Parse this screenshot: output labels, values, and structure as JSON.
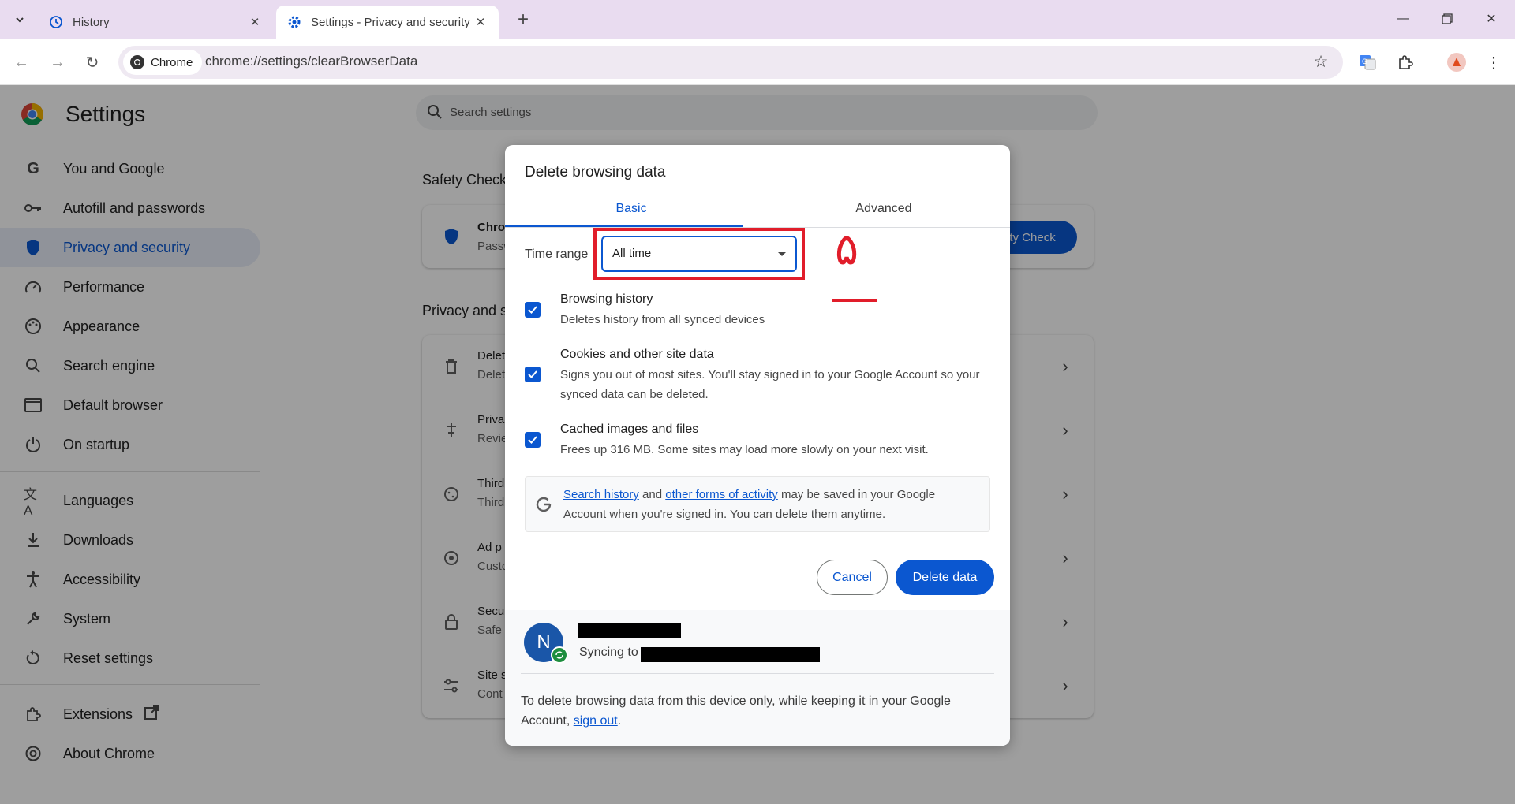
{
  "browser": {
    "tabs": [
      {
        "title": "History",
        "icon": "history-icon"
      },
      {
        "title": "Settings - Privacy and security",
        "icon": "gear-icon"
      }
    ],
    "chip_label": "Chrome",
    "url": "chrome://settings/clearBrowserData"
  },
  "settings": {
    "title": "Settings",
    "search_placeholder": "Search settings",
    "nav": [
      {
        "label": "You and Google",
        "icon": "google-g-icon"
      },
      {
        "label": "Autofill and passwords",
        "icon": "key-icon"
      },
      {
        "label": "Privacy and security",
        "icon": "shield-icon",
        "active": true
      },
      {
        "label": "Performance",
        "icon": "speedometer-icon"
      },
      {
        "label": "Appearance",
        "icon": "palette-icon"
      },
      {
        "label": "Search engine",
        "icon": "search-icon"
      },
      {
        "label": "Default browser",
        "icon": "browser-window-icon"
      },
      {
        "label": "On startup",
        "icon": "power-icon"
      },
      {
        "label": "Languages",
        "icon": "translate-icon"
      },
      {
        "label": "Downloads",
        "icon": "download-icon"
      },
      {
        "label": "Accessibility",
        "icon": "accessibility-icon"
      },
      {
        "label": "System",
        "icon": "wrench-icon"
      },
      {
        "label": "Reset settings",
        "icon": "reset-icon"
      },
      {
        "label": "Extensions",
        "icon": "puzzle-icon"
      },
      {
        "label": "About Chrome",
        "icon": "chrome-icon"
      }
    ],
    "safety_check_title": "Safety Check",
    "safety_row_title": "Chron",
    "safety_row_sub": "Passw",
    "safety_button": "ety Check",
    "privacy_title": "Privacy and s",
    "privacy_rows": [
      {
        "title": "Delet",
        "sub": "Delet",
        "icon": "trash-icon"
      },
      {
        "title": "Priva",
        "sub": "Revie",
        "icon": "tune-icon"
      },
      {
        "title": "Third",
        "sub": "Third",
        "icon": "cookie-icon"
      },
      {
        "title": "Ad p",
        "sub": "Custo",
        "icon": "ad-privacy-icon"
      },
      {
        "title": "Secu",
        "sub": "Safe",
        "icon": "lock-icon"
      },
      {
        "title": "Site s",
        "sub": "Cont",
        "icon": "sliders-icon"
      }
    ]
  },
  "dialog": {
    "title": "Delete browsing data",
    "tabs": [
      "Basic",
      "Advanced"
    ],
    "time_range_label": "Time range",
    "time_range_value": "All time",
    "annotation_glyph": "۵",
    "options": [
      {
        "title": "Browsing history",
        "desc": "Deletes history from all synced devices",
        "checked": true
      },
      {
        "title": "Cookies and other site data",
        "desc": "Signs you out of most sites. You'll stay signed in to your Google Account so your synced data can be deleted.",
        "checked": true
      },
      {
        "title": "Cached images and files",
        "desc": "Frees up 316 MB. Some sites may load more slowly on your next visit.",
        "checked": true
      }
    ],
    "google_notice": {
      "link1": "Search history",
      "mid1": " and ",
      "link2": "other forms of activity",
      "rest": " may be saved in your Google Account when you're signed in. You can delete them anytime."
    },
    "cancel_label": "Cancel",
    "delete_label": "Delete data",
    "account_initial": "N",
    "syncing_label": "Syncing to",
    "footer_text": "To delete browsing data from this device only, while keeping it in your Google Account, ",
    "signout_link": "sign out",
    "footer_end": "."
  },
  "colors": {
    "accent": "#0b57d0",
    "highlight": "#e11d2a",
    "tabstrip": "#e9dcf0"
  }
}
